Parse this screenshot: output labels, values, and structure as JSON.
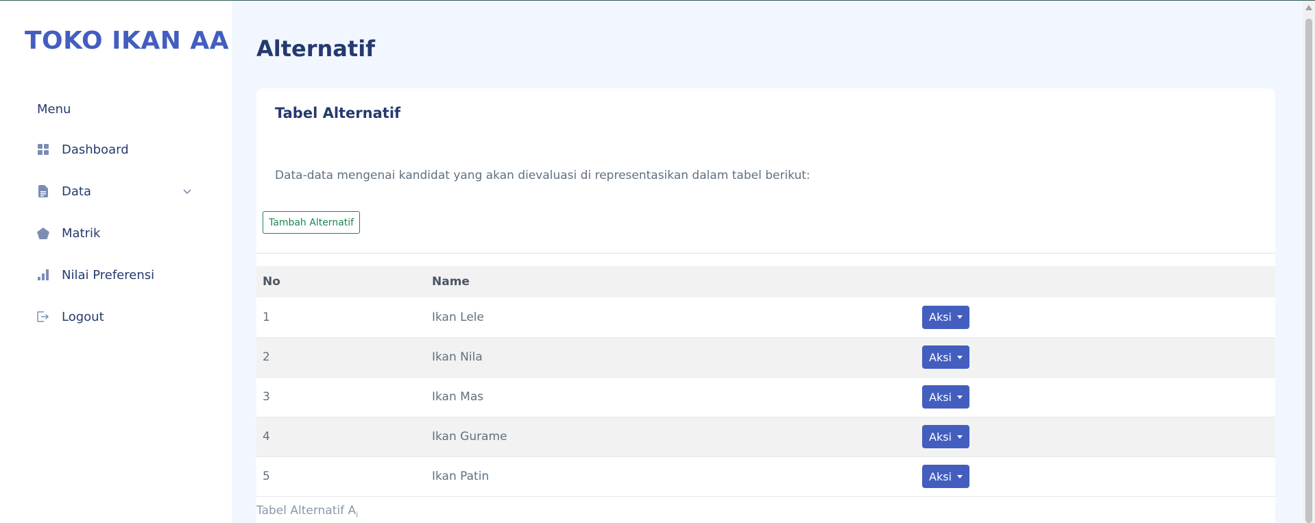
{
  "brand": "TOKO IKAN AA",
  "sidebar": {
    "menu_title": "Menu",
    "items": [
      {
        "label": "Dashboard",
        "icon": "grid-icon"
      },
      {
        "label": "Data",
        "icon": "document-icon",
        "has_submenu": true
      },
      {
        "label": "Matrik",
        "icon": "pentagon-icon"
      },
      {
        "label": "Nilai Preferensi",
        "icon": "bar-chart-icon"
      },
      {
        "label": "Logout",
        "icon": "logout-icon"
      }
    ]
  },
  "page": {
    "title": "Alternatif"
  },
  "card": {
    "title": "Tabel Alternatif",
    "description": "Data-data mengenai kandidat yang akan dievaluasi di representasikan dalam tabel berikut:",
    "add_button": "Tambah Alternatif",
    "table": {
      "headers": [
        "No",
        "Name",
        ""
      ],
      "rows": [
        {
          "no": "1",
          "name": "Ikan Lele",
          "action": "Aksi"
        },
        {
          "no": "2",
          "name": "Ikan Nila",
          "action": "Aksi"
        },
        {
          "no": "3",
          "name": "Ikan Mas",
          "action": "Aksi"
        },
        {
          "no": "4",
          "name": "Ikan Gurame",
          "action": "Aksi"
        },
        {
          "no": "5",
          "name": "Ikan Patin",
          "action": "Aksi"
        }
      ]
    },
    "caption": "Tabel Alternatif A",
    "caption_sub": "i"
  },
  "colors": {
    "brand": "#435ebe",
    "page_bg": "#f2f7ff",
    "text_primary": "#25396f",
    "success": "#198754",
    "button_primary": "#435ebe"
  }
}
